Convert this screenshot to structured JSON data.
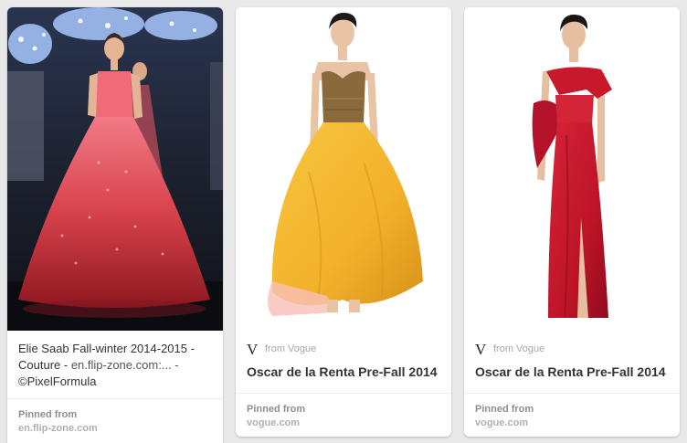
{
  "colors": {
    "background": "#e9e9e9",
    "card": "#ffffff",
    "coral_gown": "#d9474d",
    "yellow_skirt": "#f2b52a",
    "bronze_bodice": "#8a6a3d",
    "red_gown": "#c4162b"
  },
  "pins": [
    {
      "image_alt": "Elie Saab couture gown on runway",
      "description": "Elie Saab Fall-winter 2014-2015 - Couture - ",
      "description_link": "en.flip-zone.com:... -",
      "description_credit": "©PixelFormula",
      "pinned_from_label": "Pinned from",
      "pinned_from_domain": "en.flip-zone.com"
    },
    {
      "image_alt": "Oscar de la Renta yellow ball gown",
      "source_icon": "vogue-v-icon",
      "source_text": "from Vogue",
      "title": "Oscar de la Renta Pre-Fall 2014",
      "pinned_from_label": "Pinned from",
      "pinned_from_domain": "vogue.com"
    },
    {
      "image_alt": "Oscar de la Renta red satin gown",
      "source_icon": "vogue-v-icon",
      "source_text": "from Vogue",
      "title": "Oscar de la Renta Pre-Fall 2014",
      "pinned_from_label": "Pinned from",
      "pinned_from_domain": "vogue.com"
    }
  ]
}
